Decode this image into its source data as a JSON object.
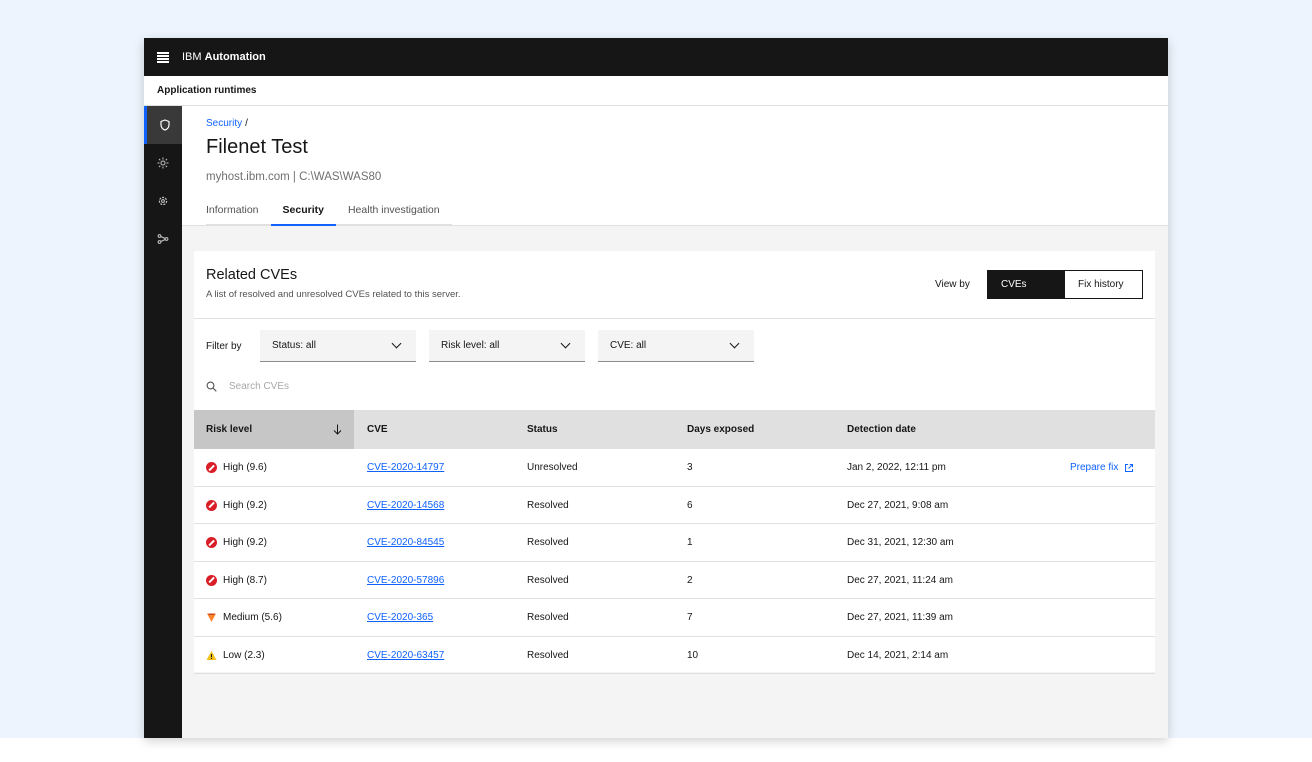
{
  "topbar": {
    "brand_prefix": "IBM",
    "brand_name": "Automation"
  },
  "appbar": {
    "title": "Application runtimes"
  },
  "header": {
    "breadcrumb": "Security",
    "breadcrumb_sep": "/",
    "title": "Filenet Test",
    "subtitle": "myhost.ibm.com | C:\\WAS\\WAS80",
    "tabs": [
      {
        "label": "Information",
        "active": false
      },
      {
        "label": "Security",
        "active": true
      },
      {
        "label": "Health investigation",
        "active": false
      }
    ]
  },
  "card": {
    "title": "Related CVEs",
    "description": "A list of resolved and unresolved CVEs related to this server.",
    "view_by_label": "View by",
    "view_options": [
      "CVEs",
      "Fix history"
    ]
  },
  "filters": {
    "label": "Filter by",
    "status": "Status: all",
    "risk": "Risk level: all",
    "cve": "CVE: all"
  },
  "search": {
    "placeholder": "Search CVEs"
  },
  "table": {
    "headers": [
      "Risk level",
      "CVE",
      "Status",
      "Days exposed",
      "Detection date"
    ],
    "action_label": "Prepare fix",
    "rows": [
      {
        "risk": "High (9.6)",
        "severity": "high",
        "cve": "CVE-2020-14797",
        "status": "Unresolved",
        "days": "3",
        "date": "Jan 2, 2022, 12:11 pm"
      },
      {
        "risk": "High (9.2)",
        "severity": "high",
        "cve": "CVE-2020-14568",
        "status": "Resolved",
        "days": "6",
        "date": "Dec 27, 2021, 9:08 am"
      },
      {
        "risk": "High (9.2)",
        "severity": "high",
        "cve": "CVE-2020-84545",
        "status": "Resolved",
        "days": "1",
        "date": "Dec 31, 2021, 12:30 am"
      },
      {
        "risk": "High (8.7)",
        "severity": "high",
        "cve": "CVE-2020-57896",
        "status": "Resolved",
        "days": "2",
        "date": "Dec 27, 2021, 11:24 am"
      },
      {
        "risk": "Medium (5.6)",
        "severity": "medium",
        "cve": "CVE-2020-365",
        "status": "Resolved",
        "days": "7",
        "date": "Dec 27, 2021, 11:39 am"
      },
      {
        "risk": "Low (2.3)",
        "severity": "low",
        "cve": "CVE-2020-63457",
        "status": "Resolved",
        "days": "10",
        "date": "Dec 14, 2021, 2:14 am"
      }
    ]
  },
  "colors": {
    "accent": "#0f62fe",
    "high": "#da1e28",
    "medium": "#ff832b",
    "low": "#f1c21b",
    "shell": "#161616"
  }
}
